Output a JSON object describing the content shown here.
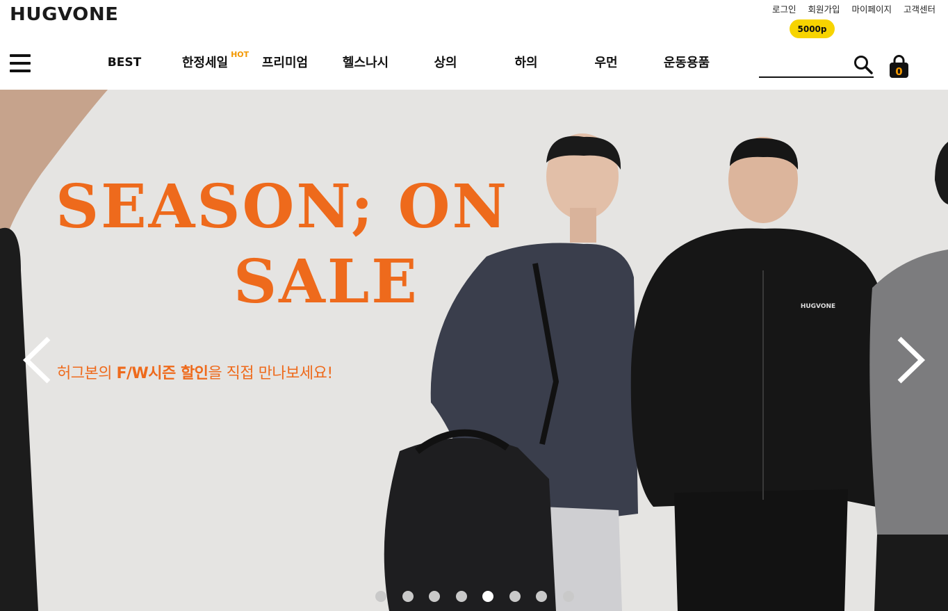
{
  "brand": {
    "logo_text": "HUGVONE"
  },
  "util_links": [
    "로그인",
    "회원가입",
    "마이페이지",
    "고객센터"
  ],
  "point_badge": "5000p",
  "nav": {
    "menu_icon": "hamburger-menu-icon",
    "items": [
      "BEST",
      "한정세일",
      "프리미엄",
      "헬스나시",
      "상의",
      "하의",
      "우먼",
      "운동용품"
    ],
    "hot_label": "HOT"
  },
  "search": {
    "placeholder": "",
    "icon": "search-icon"
  },
  "cart": {
    "icon": "shopping-bag-icon"
  },
  "hero": {
    "headline_line1": "SEASON; ON",
    "headline_line2": "SALE",
    "sub_pre": "허그본의 ",
    "sub_bold1": "F/W시즌 할인",
    "sub_post": "을 직접 만나보세요!",
    "prev_icon": "chevron-left-icon",
    "next_icon": "chevron-right-icon",
    "accent_color": "#ee6a1c",
    "slide_count": 8,
    "active_slide": 5
  },
  "colors": {
    "badge": "#f7d400",
    "hot": "#f39800",
    "hero_bg": "#e5e4e2"
  }
}
